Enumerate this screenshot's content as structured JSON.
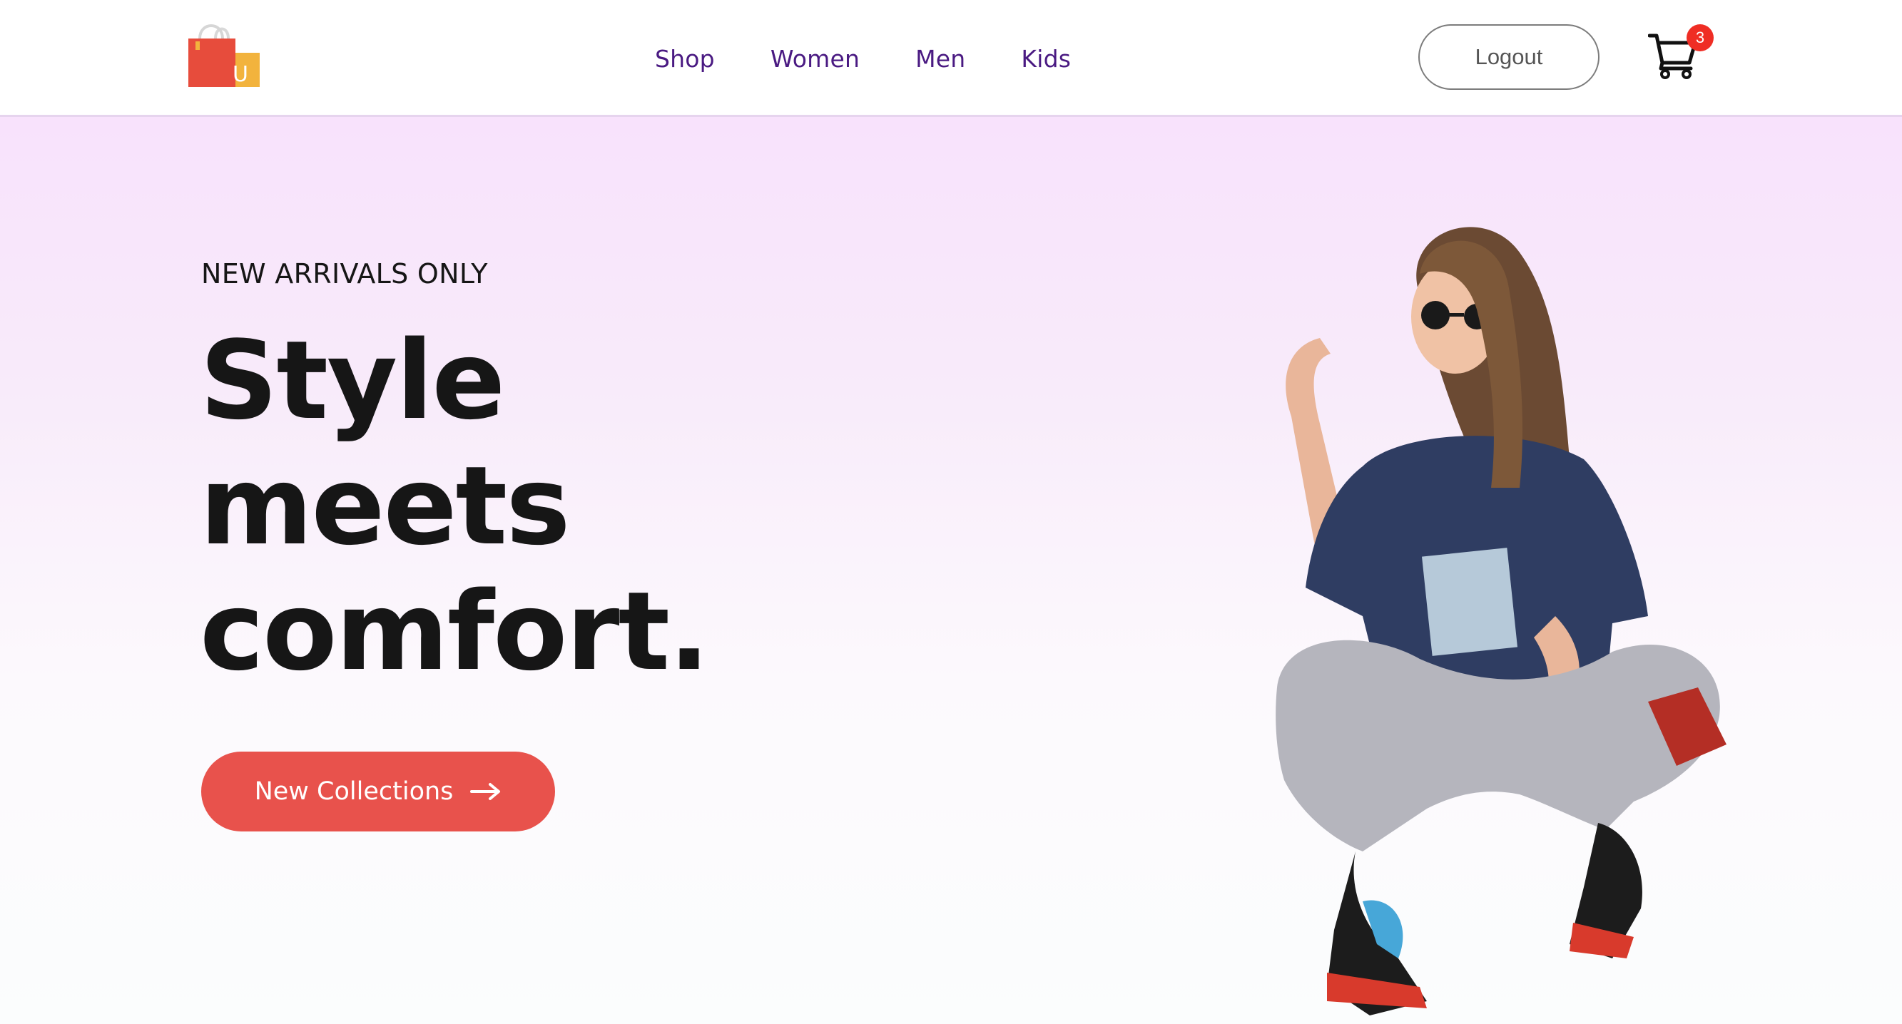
{
  "brand": {
    "logo_letter": "U",
    "logo_colors": {
      "front_bag": "#e74c3c",
      "back_bag": "#f2b33d"
    }
  },
  "nav": {
    "links": [
      {
        "label": "Shop"
      },
      {
        "label": "Women"
      },
      {
        "label": "Men"
      },
      {
        "label": "Kids"
      }
    ],
    "link_color": "#4a1a82"
  },
  "header": {
    "logout_label": "Logout",
    "cart_icon": "cart-icon",
    "cart_count": "3",
    "badge_color": "#ef2d24"
  },
  "hero": {
    "eyebrow": "NEW ARRIVALS ONLY",
    "headline": {
      "line1": "Style",
      "line2": "meets",
      "line3": "comfort."
    },
    "cta_label": "New Collections",
    "cta_icon": "arrow-right-icon",
    "cta_color": "#e8524c",
    "image_icon": "hero-model-image"
  }
}
